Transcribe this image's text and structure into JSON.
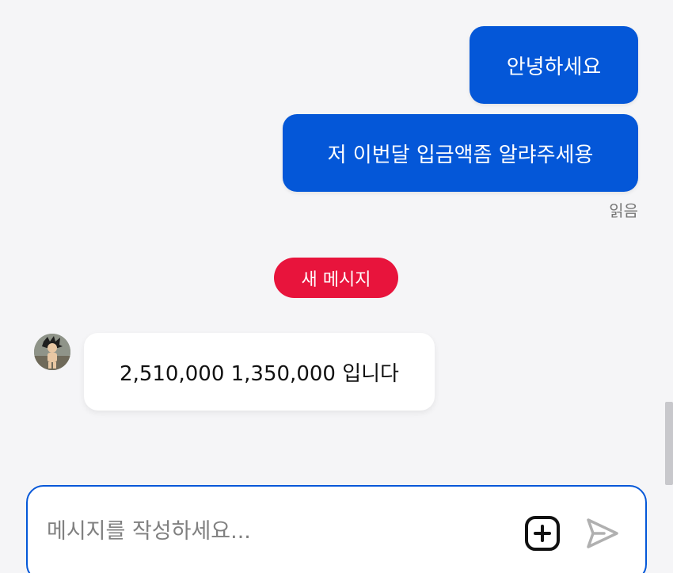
{
  "messages": {
    "outgoing": [
      {
        "text": "안녕하세요"
      },
      {
        "text": "저 이번달 입금액좀 알랴주세용"
      }
    ],
    "read_receipt": "읽음",
    "new_message_divider": "새 메시지",
    "incoming": [
      {
        "text": "2,510,000 1,350,000 입니다",
        "avatar": "avatar"
      }
    ]
  },
  "composer": {
    "placeholder": "메시지를 작성하세요...",
    "value": "",
    "attach_icon": "plus-square-icon",
    "send_icon": "send-arrow-icon"
  },
  "colors": {
    "outgoing_bubble": "#0457d8",
    "new_message_badge": "#e8143c",
    "incoming_bubble": "#ffffff",
    "background": "#f5f5f7",
    "composer_border": "#0457d8"
  }
}
